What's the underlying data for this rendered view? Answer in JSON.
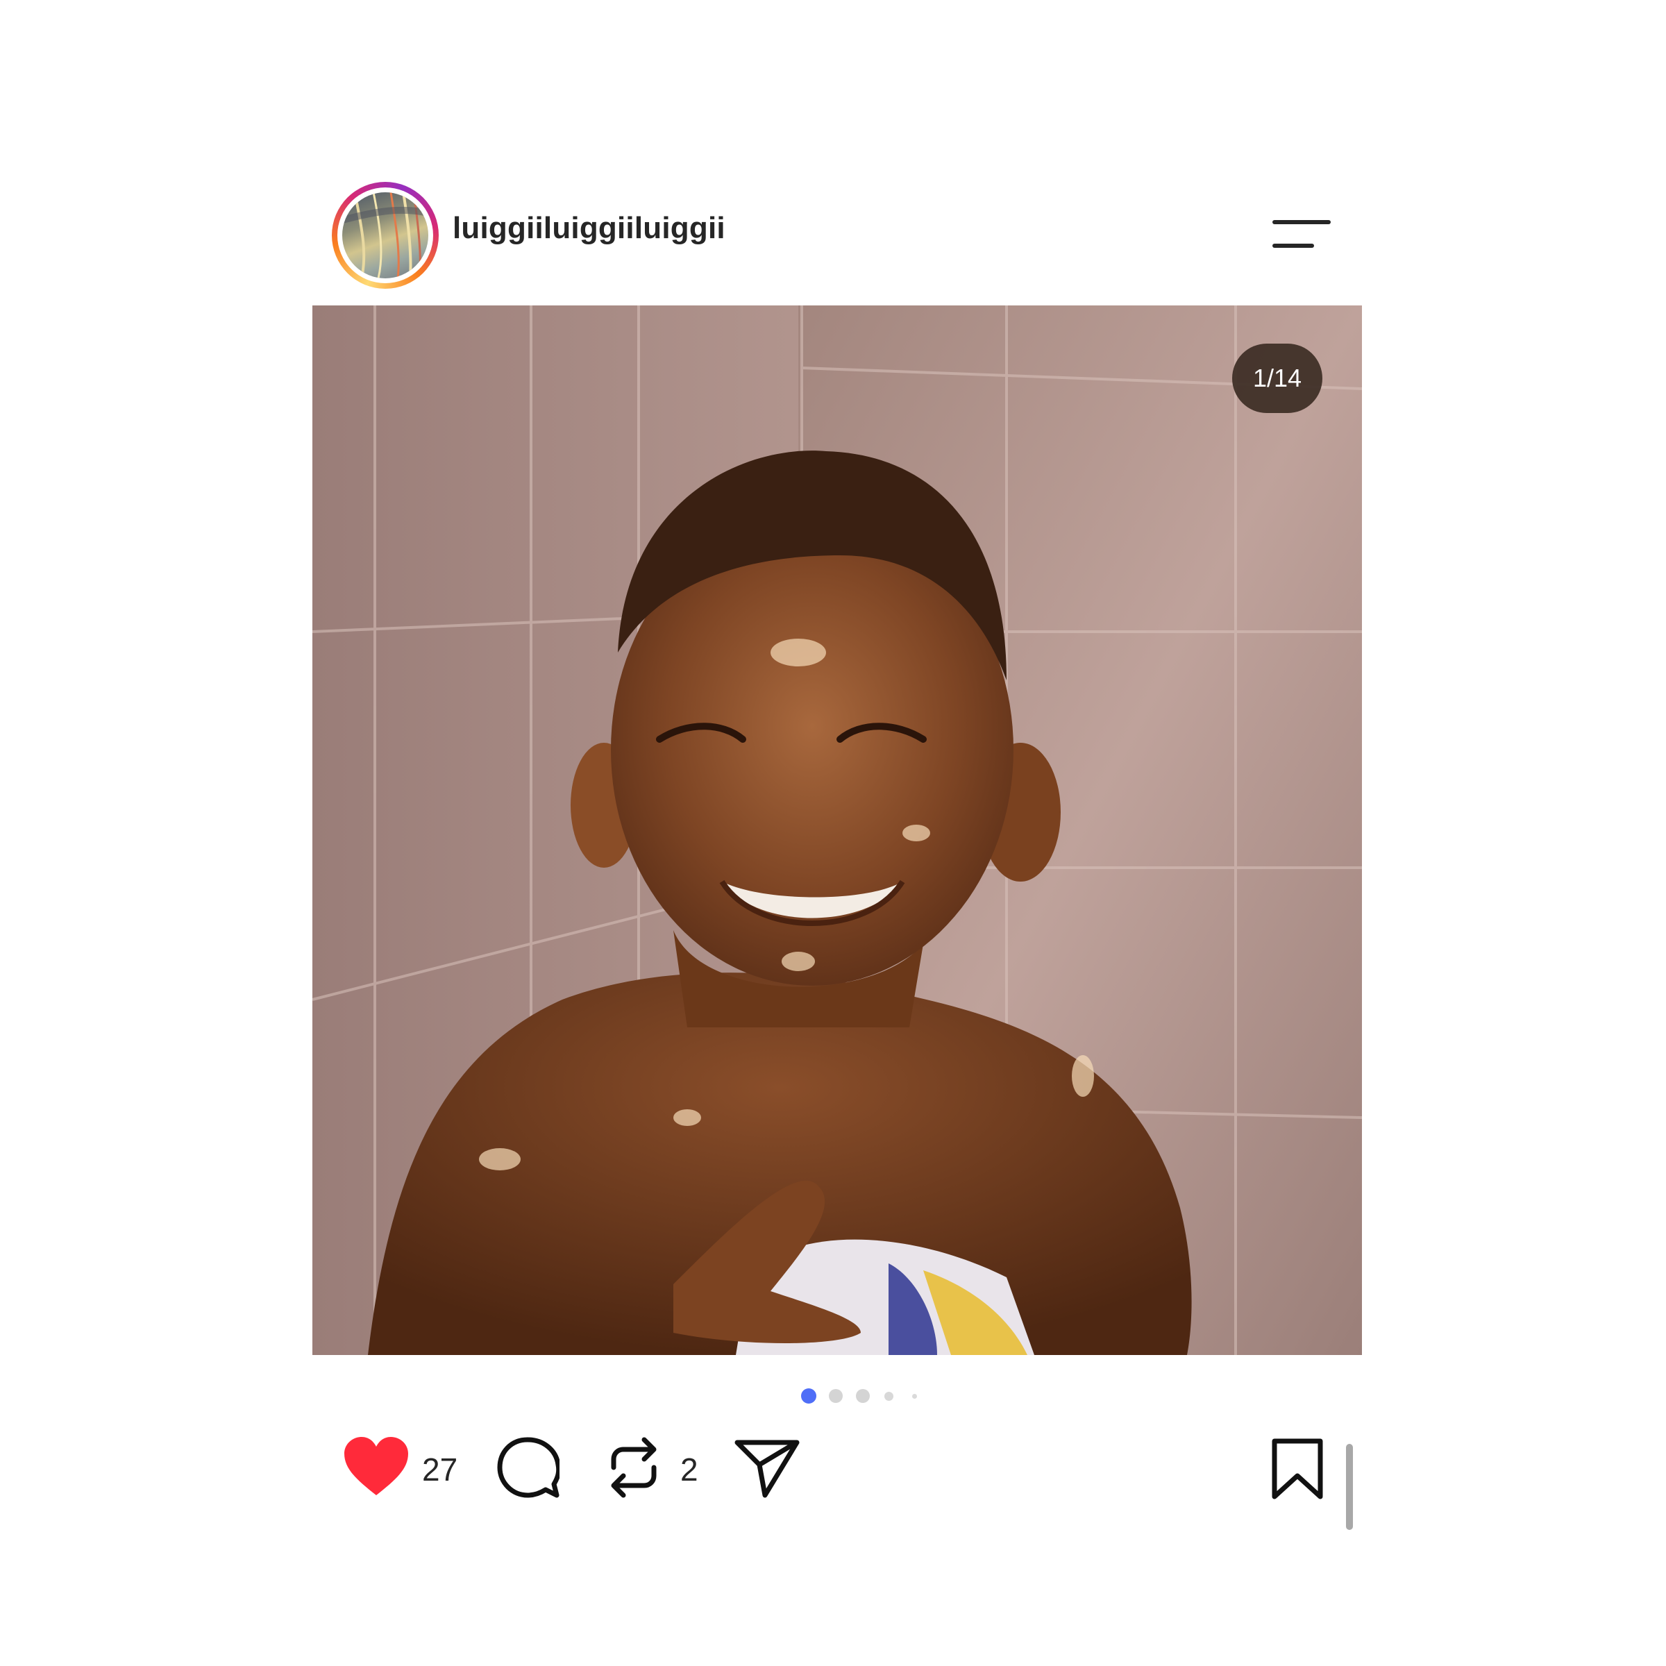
{
  "post": {
    "username": "luiggiiluiggiiluiggii",
    "media_counter": "1/14",
    "carousel_active_index": 0
  },
  "actions": {
    "likes_count": "27",
    "reposts_count": "2",
    "liked": true
  },
  "icons": {
    "menu": "menu-lines-icon",
    "like": "heart-icon",
    "comment": "comment-bubble-icon",
    "repost": "repost-arrows-icon",
    "share": "paper-plane-icon",
    "save": "bookmark-icon"
  },
  "colors": {
    "heart": "#ff2a3a",
    "active_dot": "#4f6ef7",
    "inactive_dot": "#cfcfcf",
    "counter_bg": "#3c2c24"
  }
}
